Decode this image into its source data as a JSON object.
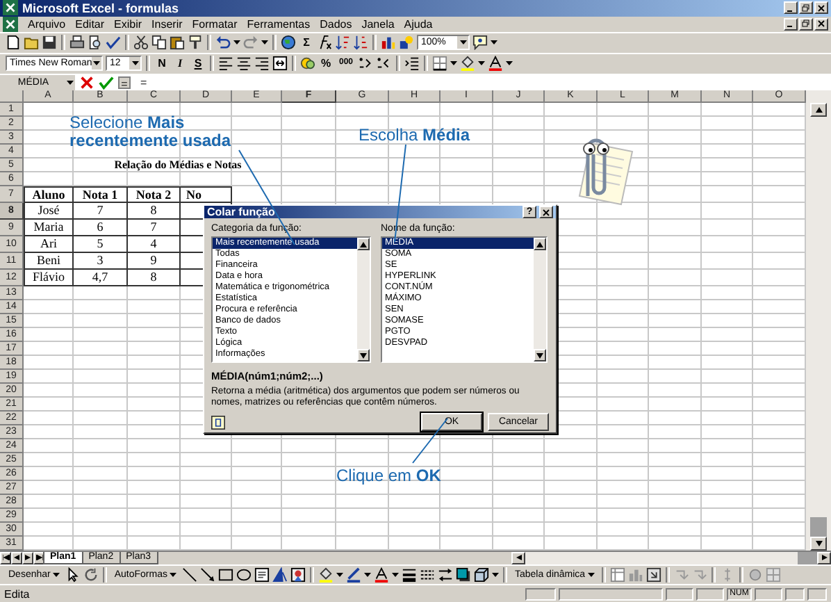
{
  "window": {
    "title": "Microsoft Excel - formulas"
  },
  "menu": [
    "Arquivo",
    "Editar",
    "Exibir",
    "Inserir",
    "Formatar",
    "Ferramentas",
    "Dados",
    "Janela",
    "Ajuda"
  ],
  "standard_toolbar": {
    "autosum": "Σ",
    "zoom": "100%"
  },
  "formatting_toolbar": {
    "font": "Times New Roman",
    "size": "12",
    "bold": "N",
    "italic": "I",
    "underline": "S",
    "percent": "%",
    "thousands": "000"
  },
  "formula_bar": {
    "name_box": "MÉDIA",
    "edit_button": "=",
    "formula": "="
  },
  "sheet": {
    "columns": [
      {
        "label": "A",
        "selected": false
      },
      {
        "label": "B",
        "selected": false
      },
      {
        "label": "C",
        "selected": false
      },
      {
        "label": "D",
        "selected": false
      },
      {
        "label": "E",
        "selected": false
      },
      {
        "label": "F",
        "selected": true
      },
      {
        "label": "G",
        "selected": false
      },
      {
        "label": "H",
        "selected": false
      },
      {
        "label": "I",
        "selected": false
      },
      {
        "label": "J",
        "selected": false
      },
      {
        "label": "K",
        "selected": false
      },
      {
        "label": "L",
        "selected": false
      },
      {
        "label": "M",
        "selected": false
      },
      {
        "label": "N",
        "selected": false
      },
      {
        "label": "O",
        "selected": false
      }
    ],
    "rows": [
      {
        "label": "1",
        "selected": false
      },
      {
        "label": "2",
        "selected": false
      },
      {
        "label": "3",
        "selected": false
      },
      {
        "label": "4",
        "selected": false
      },
      {
        "label": "5",
        "selected": false
      },
      {
        "label": "6",
        "selected": false
      },
      {
        "label": "7",
        "selected": false
      },
      {
        "label": "8",
        "selected": true
      },
      {
        "label": "9",
        "selected": false
      },
      {
        "label": "10",
        "selected": false
      },
      {
        "label": "11",
        "selected": false
      },
      {
        "label": "12",
        "selected": false
      },
      {
        "label": "13",
        "selected": false
      },
      {
        "label": "14",
        "selected": false
      },
      {
        "label": "15",
        "selected": false
      },
      {
        "label": "16",
        "selected": false
      },
      {
        "label": "17",
        "selected": false
      },
      {
        "label": "18",
        "selected": false
      },
      {
        "label": "19",
        "selected": false
      },
      {
        "label": "20",
        "selected": false
      },
      {
        "label": "21",
        "selected": false
      },
      {
        "label": "22",
        "selected": false
      },
      {
        "label": "23",
        "selected": false
      },
      {
        "label": "24",
        "selected": false
      },
      {
        "label": "25",
        "selected": false
      },
      {
        "label": "26",
        "selected": false
      },
      {
        "label": "27",
        "selected": false
      },
      {
        "label": "28",
        "selected": false
      },
      {
        "label": "29",
        "selected": false
      },
      {
        "label": "30",
        "selected": false
      },
      {
        "label": "31",
        "selected": false
      }
    ],
    "title": "Relação do Médias e Notas",
    "table": {
      "columns": [
        "Aluno",
        "Nota 1",
        "Nota 2",
        "No"
      ],
      "rows": [
        [
          "José",
          "7",
          "8"
        ],
        [
          "Maria",
          "6",
          "7"
        ],
        [
          "Ari",
          "5",
          "4"
        ],
        [
          "Beni",
          "3",
          "9"
        ],
        [
          "Flávio",
          "4,7",
          "8"
        ]
      ]
    }
  },
  "sheet_tabs": [
    {
      "label": "Plan1",
      "selected": true
    },
    {
      "label": "Plan2",
      "selected": false
    },
    {
      "label": "Plan3",
      "selected": false
    }
  ],
  "drawing_toolbar": {
    "draw_menu": "Desenhar",
    "autoshapes": "AutoFormas",
    "pivot": "Tabela dinâmica"
  },
  "status_bar": {
    "mode": "Edita",
    "num": "NUM"
  },
  "dialog": {
    "title": "Colar função",
    "help": "?",
    "category_label": "Categoria da função:",
    "categories": [
      {
        "label": "Mais recentemente usada",
        "selected": true
      },
      {
        "label": "Todas",
        "selected": false
      },
      {
        "label": "Financeira",
        "selected": false
      },
      {
        "label": "Data e hora",
        "selected": false
      },
      {
        "label": "Matemática e trigonométrica",
        "selected": false
      },
      {
        "label": "Estatística",
        "selected": false
      },
      {
        "label": "Procura e referência",
        "selected": false
      },
      {
        "label": "Banco de dados",
        "selected": false
      },
      {
        "label": "Texto",
        "selected": false
      },
      {
        "label": "Lógica",
        "selected": false
      },
      {
        "label": "Informações",
        "selected": false
      }
    ],
    "name_label": "Nome da função:",
    "functions": [
      {
        "label": "MÉDIA",
        "selected": true
      },
      {
        "label": "SOMA",
        "selected": false
      },
      {
        "label": "SE",
        "selected": false
      },
      {
        "label": "HYPERLINK",
        "selected": false
      },
      {
        "label": "CONT.NÚM",
        "selected": false
      },
      {
        "label": "MÁXIMO",
        "selected": false
      },
      {
        "label": "SEN",
        "selected": false
      },
      {
        "label": "SOMASE",
        "selected": false
      },
      {
        "label": "PGTO",
        "selected": false
      },
      {
        "label": "DESVPAD",
        "selected": false
      }
    ],
    "syntax": "MÉDIA(núm1;núm2;...)",
    "description": "Retorna a média (aritmética) dos argumentos que podem ser números ou nomes, matrizes ou referências que contêm números.",
    "buttons": [
      {
        "label": "OK",
        "kind": "default"
      },
      {
        "label": "Cancelar",
        "kind": "normal"
      }
    ]
  },
  "annotations": [
    {
      "text": "Selecione **Mais recentemente usada**"
    },
    {
      "text": "Escolha **Média**"
    },
    {
      "text": "Clique em **OK**"
    }
  ]
}
